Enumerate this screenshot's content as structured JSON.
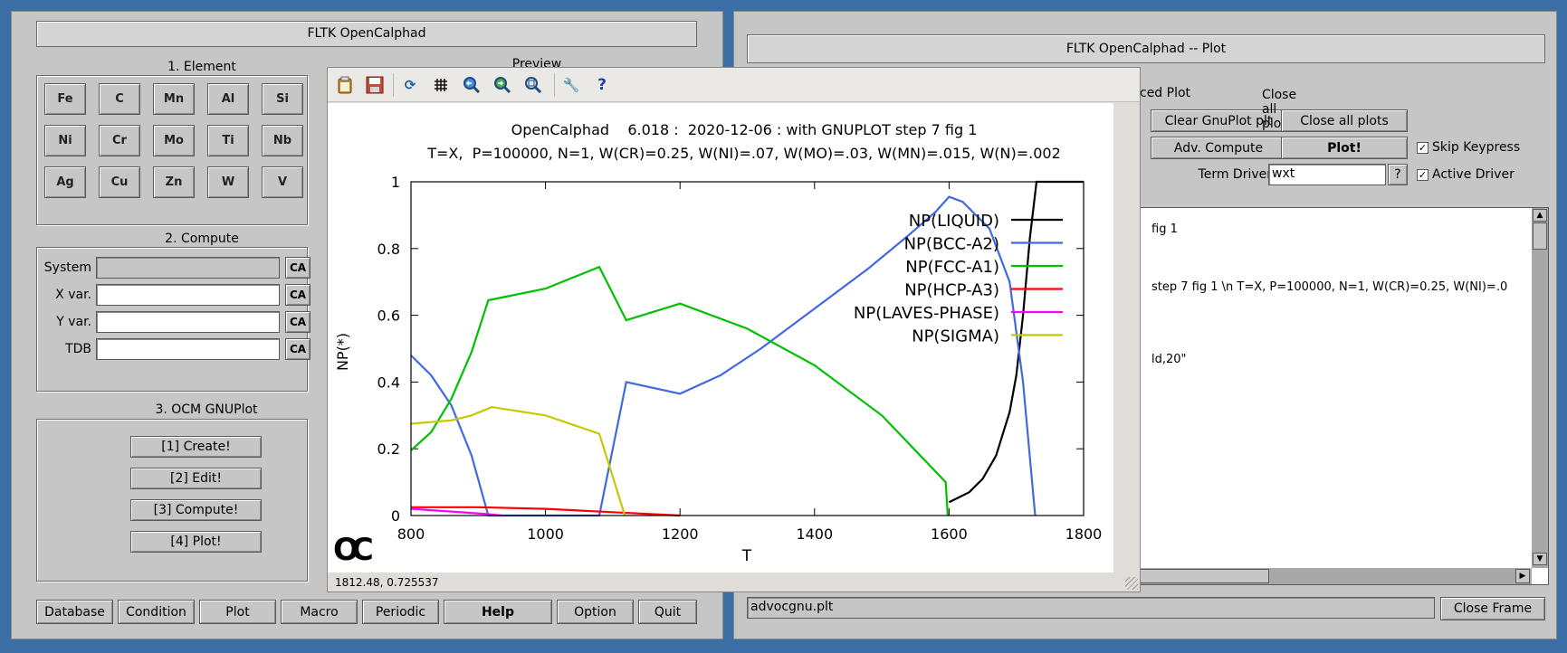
{
  "main_window": {
    "title": "FLTK OpenCalphad",
    "preview_label": "Preview",
    "element_group": {
      "label": "1. Element",
      "elements": [
        "Fe",
        "C",
        "Mn",
        "Al",
        "Si",
        "Ni",
        "Cr",
        "Mo",
        "Ti",
        "Nb",
        "Ag",
        "Cu",
        "Zn",
        "W",
        "V"
      ]
    },
    "compute_group": {
      "label": "2. Compute",
      "fields": [
        {
          "label": "System",
          "value": "",
          "ca": "CA"
        },
        {
          "label": "X var.",
          "value": "",
          "ca": "CA"
        },
        {
          "label": "Y var.",
          "value": "",
          "ca": "CA"
        },
        {
          "label": "TDB",
          "value": "",
          "ca": "CA"
        }
      ]
    },
    "gnuplot_group": {
      "label": "3. OCM GNUPlot",
      "buttons": [
        "[1] Create!",
        "[2] Edit!",
        "[3] Compute!",
        "[4] Plot!"
      ]
    },
    "bottom_menu": [
      "Database",
      "Condition",
      "Plot",
      "Macro",
      "Periodic",
      "Help",
      "Option",
      "Quit"
    ]
  },
  "plot_window": {
    "title": "FLTK OpenCalphad -- Plot",
    "section_label_partial": "ced Plot",
    "buttons": {
      "clear": "Clear GnuPlot plt",
      "close_all": "Close all plots",
      "adv_compute": "Adv. Compute",
      "plot": "Plot!"
    },
    "skip_keypress": {
      "label": "Skip Keypress",
      "checked": true
    },
    "active_driver": {
      "label": "Active Driver",
      "checked": true
    },
    "term_driver": {
      "label": "Term Driver",
      "value": "wxt",
      "help": "?"
    },
    "text_lines": [
      "fig 1",
      "step 7 fig 1 \\n T=X,  P=100000, N=1, W(CR)=0.25, W(NI)=.0",
      "ld,20\""
    ],
    "file_field": "advocgnu.plt",
    "close_frame": "Close Frame"
  },
  "gnuplot_window": {
    "status": "1812.48,  0.725537",
    "logo": "OC",
    "toolbar_icons": [
      "clipboard-icon",
      "save-icon",
      "refresh-icon",
      "grid-icon",
      "zoom-prev-icon",
      "zoom-next-icon",
      "autoscale-icon",
      "config-icon",
      "help-icon"
    ]
  },
  "chart_data": {
    "type": "line",
    "title": "OpenCalphad    6.018 :  2020-12-06 : with GNUPLOT step 7 fig 1",
    "subtitle": "T=X,  P=100000, N=1, W(CR)=0.25, W(NI)=.07, W(MO)=.03, W(MN)=.015, W(N)=.002",
    "xlabel": "T",
    "ylabel": "NP(*)",
    "xlim": [
      800,
      1800
    ],
    "ylim": [
      0,
      1
    ],
    "xticks": [
      800,
      1000,
      1200,
      1400,
      1600,
      1800
    ],
    "yticks": [
      0,
      0.2,
      0.4,
      0.6,
      0.8,
      1
    ],
    "legend_position": "top-right",
    "series": [
      {
        "name": "NP(LIQUID)",
        "color": "#000000",
        "x": [
          1600,
          1610,
          1630,
          1650,
          1670,
          1690,
          1700,
          1710,
          1720,
          1730,
          1800
        ],
        "y": [
          0.04,
          0.05,
          0.07,
          0.11,
          0.18,
          0.31,
          0.42,
          0.6,
          0.83,
          1.0,
          1.0
        ]
      },
      {
        "name": "NP(BCC-A2)",
        "color": "#4169e1",
        "x": [
          800,
          830,
          860,
          890,
          915,
          1080,
          1120,
          1200,
          1260,
          1320,
          1400,
          1480,
          1540,
          1580,
          1600,
          1620,
          1660,
          1690,
          1710,
          1728
        ],
        "y": [
          0.48,
          0.42,
          0.33,
          0.18,
          0.0,
          0.0,
          0.4,
          0.365,
          0.42,
          0.5,
          0.62,
          0.74,
          0.84,
          0.91,
          0.955,
          0.94,
          0.86,
          0.7,
          0.4,
          0.0
        ]
      },
      {
        "name": "NP(FCC-A1)",
        "color": "#00c000",
        "x": [
          800,
          830,
          860,
          890,
          915,
          1000,
          1080,
          1120,
          1200,
          1300,
          1400,
          1500,
          1595,
          1598
        ],
        "y": [
          0.195,
          0.25,
          0.35,
          0.49,
          0.645,
          0.68,
          0.745,
          0.585,
          0.635,
          0.56,
          0.45,
          0.3,
          0.1,
          0.0
        ]
      },
      {
        "name": "NP(HCP-A3)",
        "color": "#ff0000",
        "x": [
          800,
          900,
          1000,
          1100,
          1200
        ],
        "y": [
          0.025,
          0.025,
          0.02,
          0.01,
          0.0
        ]
      },
      {
        "name": "NP(LAVES-PHASE)",
        "color": "#ff00ff",
        "x": [
          800,
          860,
          915,
          935
        ],
        "y": [
          0.02,
          0.012,
          0.004,
          0.0
        ]
      },
      {
        "name": "NP(SIGMA)",
        "color": "#c8c800",
        "x": [
          800,
          860,
          890,
          920,
          1000,
          1080,
          1118
        ],
        "y": [
          0.275,
          0.285,
          0.3,
          0.325,
          0.3,
          0.245,
          0.0
        ]
      }
    ]
  }
}
